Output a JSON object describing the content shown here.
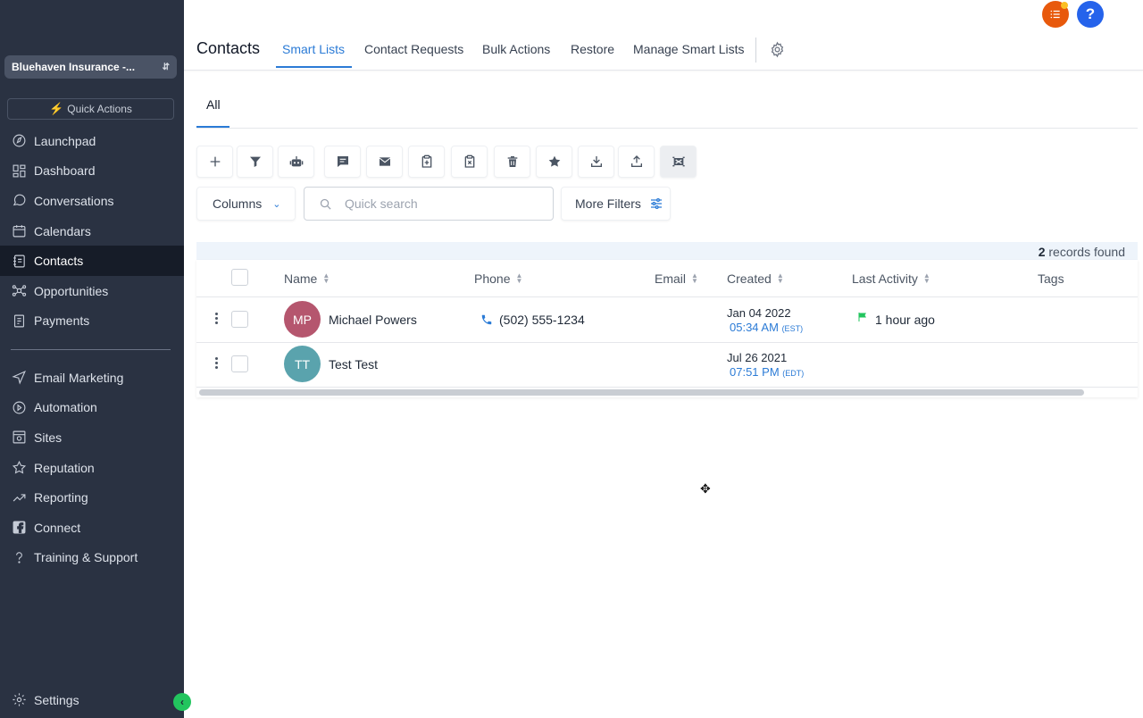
{
  "sidebar": {
    "account_name": "Bluehaven Insurance -...",
    "quick_actions_label": "Quick Actions",
    "items": [
      {
        "label": "Launchpad",
        "icon": "launchpad-icon"
      },
      {
        "label": "Dashboard",
        "icon": "dashboard-icon"
      },
      {
        "label": "Conversations",
        "icon": "chat-icon"
      },
      {
        "label": "Calendars",
        "icon": "calendar-icon"
      },
      {
        "label": "Contacts",
        "icon": "contacts-icon",
        "active": true
      },
      {
        "label": "Opportunities",
        "icon": "opportunities-icon"
      },
      {
        "label": "Payments",
        "icon": "payments-icon"
      }
    ],
    "items2": [
      {
        "label": "Email Marketing",
        "icon": "send-icon"
      },
      {
        "label": "Automation",
        "icon": "automation-icon"
      },
      {
        "label": "Sites",
        "icon": "sites-icon"
      },
      {
        "label": "Reputation",
        "icon": "star-icon"
      },
      {
        "label": "Reporting",
        "icon": "reporting-icon"
      },
      {
        "label": "Connect",
        "icon": "facebook-icon"
      },
      {
        "label": "Training & Support",
        "icon": "question-icon"
      }
    ],
    "settings_label": "Settings"
  },
  "header": {
    "title": "Contacts",
    "tabs": [
      {
        "label": "Smart Lists",
        "active": true
      },
      {
        "label": "Contact Requests"
      },
      {
        "label": "Bulk Actions"
      },
      {
        "label": "Restore"
      },
      {
        "label": "Manage Smart Lists"
      }
    ],
    "help_label": "?"
  },
  "subtabs": {
    "all_label": "All"
  },
  "toolbar": {
    "icons": [
      "add-icon",
      "filter-icon",
      "robot-icon",
      "sms-icon",
      "email-icon",
      "add-tag-icon",
      "remove-tag-icon",
      "delete-icon",
      "star-icon",
      "import-icon",
      "export-icon",
      "merge-icon"
    ]
  },
  "filters": {
    "columns_label": "Columns",
    "search_placeholder": "Quick search",
    "more_filters_label": "More Filters"
  },
  "table": {
    "records_count": "2",
    "records_suffix": " records found",
    "columns": [
      "Name",
      "Phone",
      "Email",
      "Created",
      "Last Activity",
      "Tags"
    ],
    "rows": [
      {
        "initials": "MP",
        "avatar_color": "#b5566e",
        "name": "Michael Powers",
        "phone": "(502) 555-1234",
        "created_date": "Jan 04 2022",
        "created_time": "05:34 AM",
        "created_tz": "(EST)",
        "last_activity": "1 hour ago"
      },
      {
        "initials": "TT",
        "avatar_color": "#5aa3ad",
        "name": "Test Test",
        "created_date": "Jul 26 2021",
        "created_time": "07:51 PM",
        "created_tz": "(EDT)"
      }
    ]
  },
  "colors": {
    "sidebar_bg": "#2a3242",
    "accent": "#2b7bd6",
    "notification": "#e8590c",
    "help": "#2563eb"
  }
}
